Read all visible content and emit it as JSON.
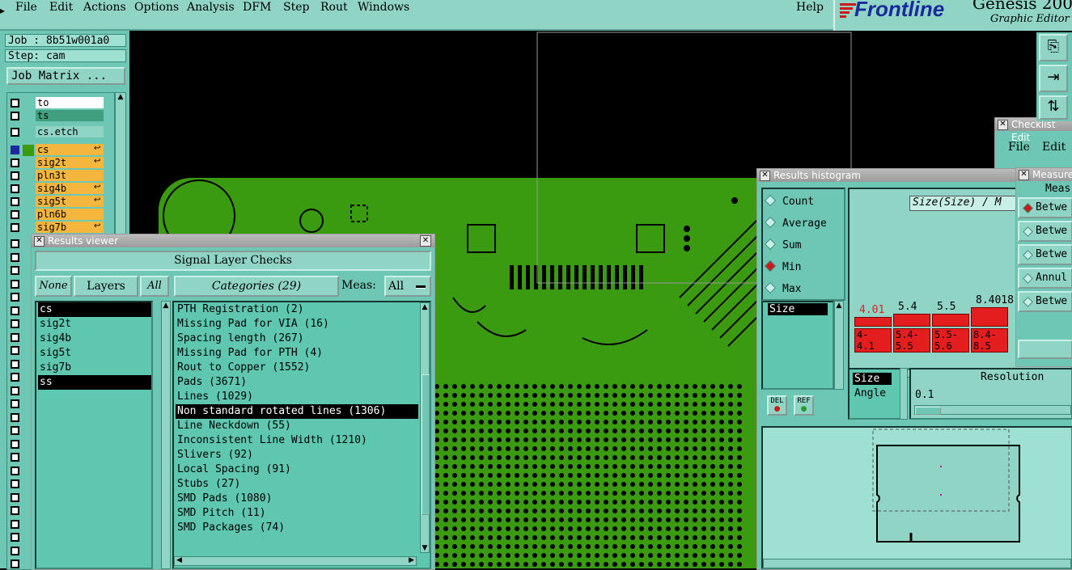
{
  "menubar": {
    "items": [
      "File",
      "Edit",
      "Actions",
      "Options",
      "Analysis",
      "DFM",
      "Step",
      "Rout",
      "Windows"
    ],
    "help": "Help"
  },
  "logo": {
    "brand": "Frontline",
    "product": "Genesis 200",
    "subtitle": "Graphic Editor"
  },
  "job": {
    "job_label": "Job : 8b51w001a0",
    "step_label": "Step: cam",
    "matrix_button": "Job Matrix ..."
  },
  "layers": [
    {
      "name": "to",
      "style": "white"
    },
    {
      "name": "ts",
      "style": "teal"
    },
    {
      "name": "cs.etch",
      "style": "gray"
    },
    {
      "name": "cs",
      "style": "orange"
    },
    {
      "name": "sig2t",
      "style": "orange"
    },
    {
      "name": "pln3t",
      "style": "orange"
    },
    {
      "name": "sig4b",
      "style": "orange"
    },
    {
      "name": "sig5t",
      "style": "orange"
    },
    {
      "name": "pln6b",
      "style": "orange"
    },
    {
      "name": "sig7b",
      "style": "orange"
    }
  ],
  "results_viewer": {
    "title": "Results viewer",
    "header": "Signal Layer Checks",
    "none_btn": "None",
    "layers_btn": "Layers",
    "all_btn": "All",
    "categories_btn": "Categories (29)",
    "meas_label": "Meas:",
    "meas_value": "All",
    "layer_list": [
      "cs",
      "sig2t",
      "sig4b",
      "sig5t",
      "sig7b",
      "ss"
    ],
    "selected_layers": [
      "cs",
      "ss"
    ],
    "categories": [
      "PTH Registration (2)",
      "Missing Pad for VIA (16)",
      "Spacing length (267)",
      "Missing Pad for PTH (4)",
      "Rout to Copper (1552)",
      "Pads (3671)",
      "Lines (1029)",
      "Non standard rotated lines (1306)",
      "Line Neckdown (55)",
      "Inconsistent Line Width (1210)",
      "Slivers (92)",
      "Local Spacing (91)",
      "Stubs (27)",
      "SMD Pads (1080)",
      "SMD Pitch (11)",
      "SMD Packages (74)"
    ],
    "selected_category": "Non standard rotated lines (1306)"
  },
  "histogram": {
    "title": "Results histogram",
    "options": [
      "Count",
      "Average",
      "Sum",
      "Min",
      "Max"
    ],
    "selected_option": "Min",
    "list_item": "Size",
    "chart_title": "Size(Size) / M",
    "bar_labels": [
      "4.01",
      "5.4",
      "5.5",
      "8.4018"
    ],
    "range_labels": [
      "4-\n4.1",
      "5.4-\n5.5",
      "5.5-\n5.6",
      "8.4-\n8.5"
    ],
    "del_label": "DEL",
    "ref_label": "REF",
    "attr_list": [
      "Size",
      "Angle"
    ],
    "resolution_label": "Resolution",
    "resolution_value": "0.1",
    "accent_red": "#e41e1e"
  },
  "checklist_editor": {
    "title": "Checklist Edit",
    "menu_file": "File",
    "menu_edit": "Edit"
  },
  "measure": {
    "title": "Measure",
    "header": "Meas",
    "options": [
      "Betwe",
      "Betwe",
      "Betwe",
      "Annul",
      "Betwe"
    ]
  }
}
